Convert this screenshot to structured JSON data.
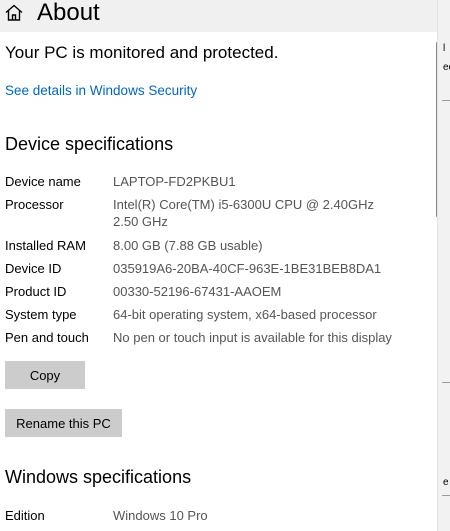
{
  "header": {
    "title": "About",
    "home_icon": "home-icon"
  },
  "status": {
    "text": "Your PC is monitored and protected."
  },
  "security_link": {
    "label": "See details in Windows Security"
  },
  "device_specs": {
    "heading": "Device specifications",
    "rows": [
      {
        "label": "Device name",
        "value": "LAPTOP-FD2PKBU1"
      },
      {
        "label": "Processor",
        "value": "Intel(R) Core(TM) i5-6300U CPU @ 2.40GHz",
        "value2": "2.50 GHz"
      },
      {
        "label": "Installed RAM",
        "value": "8.00 GB (7.88 GB usable)"
      },
      {
        "label": "Device ID",
        "value": "035919A6-20BA-40CF-963E-1BE31BEB8DA1"
      },
      {
        "label": "Product ID",
        "value": "00330-52196-67431-AAOEM"
      },
      {
        "label": "System type",
        "value": "64-bit operating system, x64-based processor"
      },
      {
        "label": "Pen and touch",
        "value": "No pen or touch input is available for this display"
      }
    ],
    "copy_button": "Copy"
  },
  "rename_button": "Rename this PC",
  "windows_specs": {
    "heading": "Windows specifications",
    "rows": [
      {
        "label": "Edition",
        "value": "Windows 10 Pro"
      }
    ]
  },
  "right_edge": {
    "glyph_top": "l",
    "glyph_mid": "ec",
    "glyph_bottom": "e"
  },
  "colors": {
    "link": "#0067c0",
    "button": "#cccccc",
    "header": "#f0f0f0",
    "value_text": "#555555"
  }
}
